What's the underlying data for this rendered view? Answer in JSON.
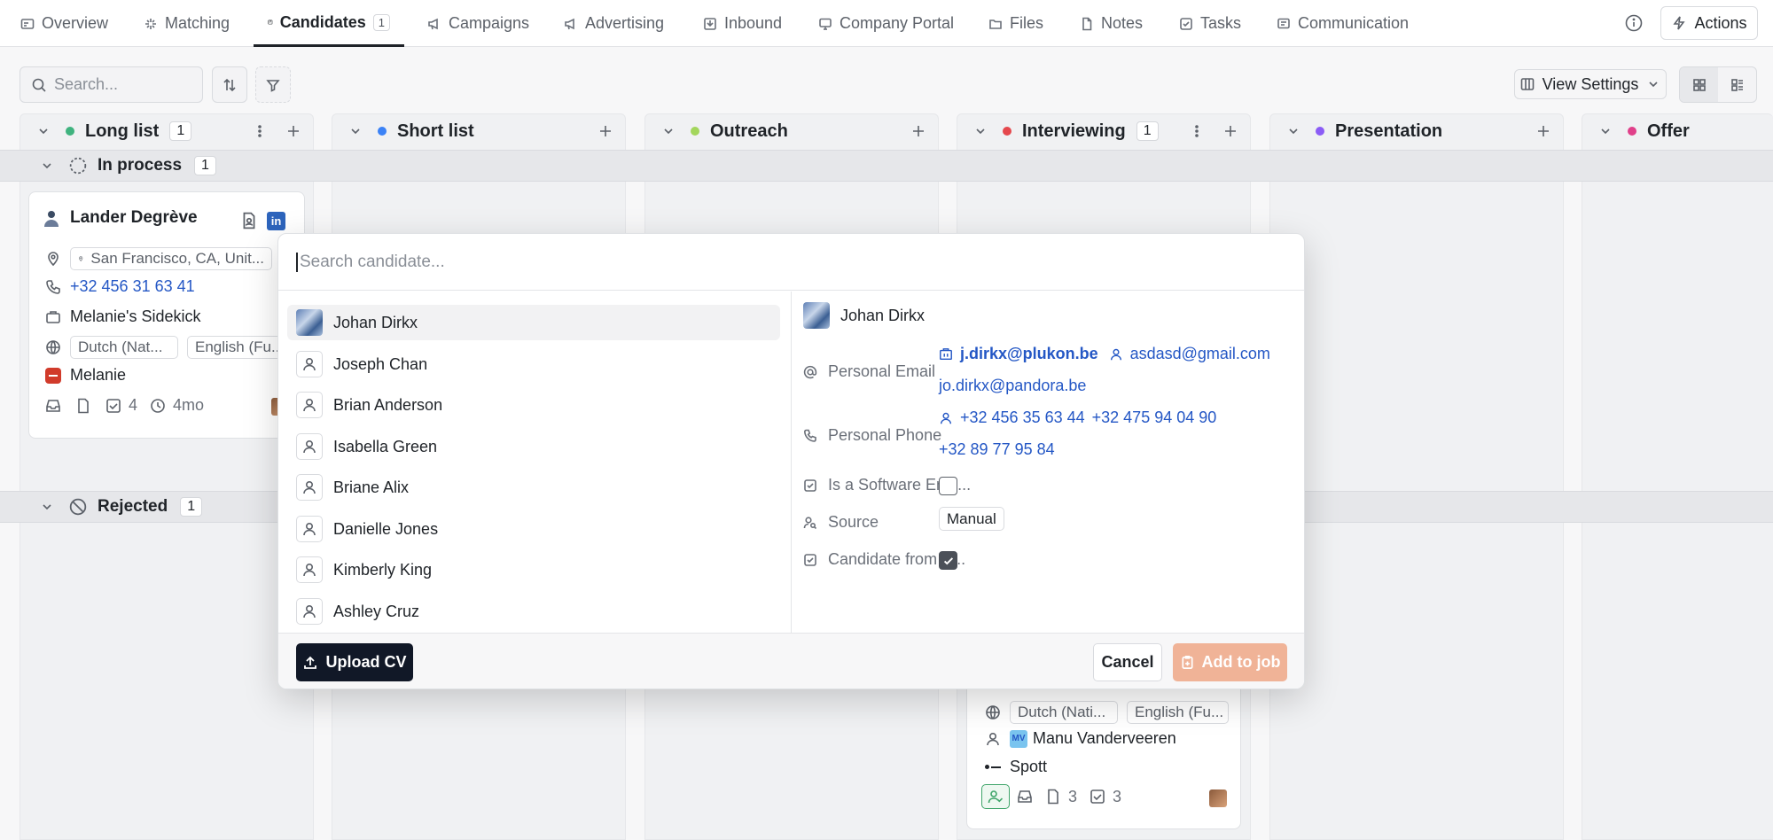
{
  "nav": {
    "tabs": [
      {
        "label": "Overview"
      },
      {
        "label": "Matching"
      },
      {
        "label": "Candidates",
        "count": "1"
      },
      {
        "label": "Campaigns"
      },
      {
        "label": "Advertising"
      },
      {
        "label": "Inbound"
      },
      {
        "label": "Company Portal"
      },
      {
        "label": "Files"
      },
      {
        "label": "Notes"
      },
      {
        "label": "Tasks"
      },
      {
        "label": "Communication"
      }
    ],
    "actions_label": "Actions"
  },
  "toolbar": {
    "search_placeholder": "Search...",
    "view_settings_label": "View Settings"
  },
  "columns": [
    {
      "name": "Long list",
      "count": "1",
      "color": "#3fb37f"
    },
    {
      "name": "Short list",
      "count": "",
      "color": "#3b82f6"
    },
    {
      "name": "Outreach",
      "count": "",
      "color": "#a3d65c"
    },
    {
      "name": "Interviewing",
      "count": "1",
      "color": "#e5484d"
    },
    {
      "name": "Presentation",
      "count": "",
      "color": "#8b5cf6"
    },
    {
      "name": "Offer",
      "count": "",
      "color": "#e0408a"
    }
  ],
  "groups": {
    "in_process": {
      "label": "In process",
      "count": "1"
    },
    "rejected": {
      "label": "Rejected",
      "count": "1"
    }
  },
  "card1": {
    "name": "Lander Degrève",
    "location": "San Francisco, CA, Unit...",
    "phone": "+32 456 31 63 41",
    "company": "Melanie's Sidekick",
    "lang1": "Dutch (Nat...",
    "lang2": "English (Fu...",
    "owner": "Melanie",
    "tasks": "4",
    "age": "4mo"
  },
  "card2": {
    "lang1": "Dutch (Nati...",
    "lang2": "English (Fu...",
    "owner_initials": "MV",
    "owner": "Manu Vanderveeren",
    "company": "Spott",
    "files": "3",
    "tasks": "3"
  },
  "modal": {
    "search_placeholder": "Search candidate...",
    "candidates": [
      "Johan Dirkx",
      "Joseph Chan",
      "Brian Anderson",
      "Isabella Green",
      "Briane Alix",
      "Danielle Jones",
      "Kimberly King",
      "Ashley Cruz"
    ],
    "detail": {
      "name": "Johan Dirkx",
      "personal_email_label": "Personal Email",
      "email_work": "j.dirkx@plukon.be",
      "email_personal": "asdasd@gmail.com",
      "email_other": "jo.dirkx@pandora.be",
      "personal_phone_label": "Personal Phone",
      "phone1": "+32 456 35 63 44",
      "phone2": "+32 475 94 04 90",
      "phone3": "+32 89 77 95 84",
      "software_label": "Is a Software Engi...",
      "software_checked": false,
      "source_label": "Source",
      "source_value": "Manual",
      "candidate_from_label": "Candidate from B...",
      "candidate_from_checked": true
    },
    "upload_label": "Upload CV",
    "cancel_label": "Cancel",
    "add_label": "Add to job"
  }
}
